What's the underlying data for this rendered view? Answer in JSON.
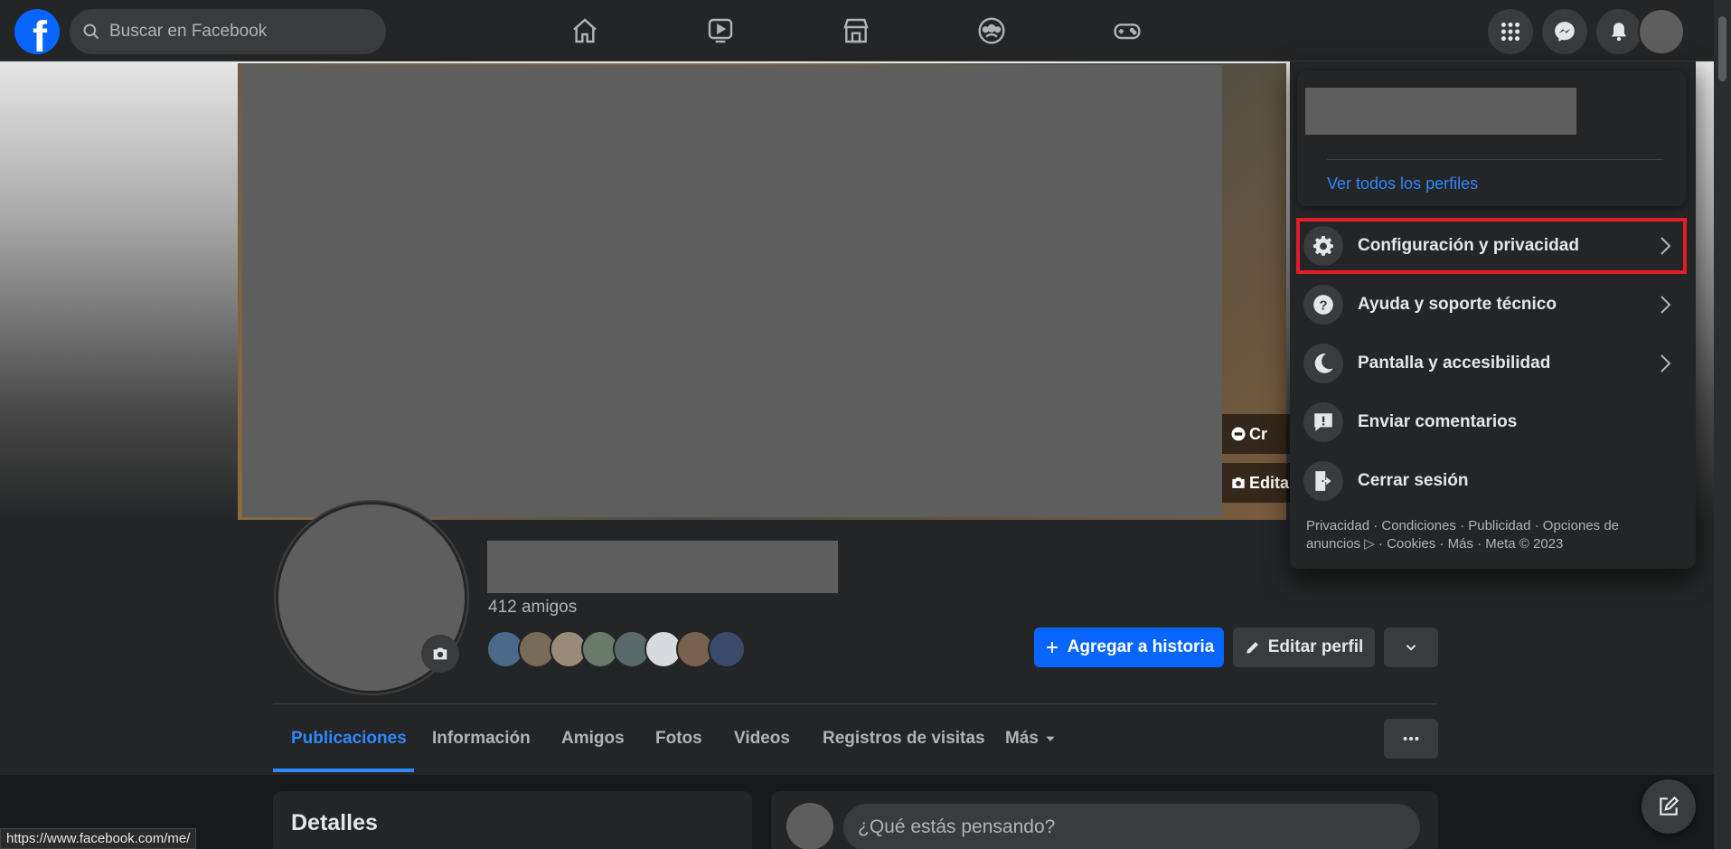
{
  "topbar": {
    "logo_letter": "f",
    "search_placeholder": "Buscar en Facebook",
    "nav_icons": [
      "home-icon",
      "video-icon",
      "marketplace-icon",
      "groups-icon",
      "gaming-icon"
    ],
    "right_icons": [
      "menu-grid-icon",
      "messenger-icon",
      "notifications-icon"
    ]
  },
  "profile": {
    "friends_count": "412 amigos",
    "add_story_label": "Agregar a historia",
    "edit_profile_label": "Editar perfil",
    "cover_buttons": [
      "Cr",
      "Edita"
    ]
  },
  "tabs": [
    "Publicaciones",
    "Información",
    "Amigos",
    "Fotos",
    "Videos",
    "Registros de visitas",
    "Más"
  ],
  "active_tab": "Publicaciones",
  "details": {
    "title": "Detalles"
  },
  "composer": {
    "placeholder": "¿Qué estás pensando?"
  },
  "dropdown": {
    "see_all_profiles": "Ver todos los perfiles",
    "items": [
      {
        "label": "Configuración y privacidad",
        "icon": "gear-icon",
        "has_chevron": true
      },
      {
        "label": "Ayuda y soporte técnico",
        "icon": "help-icon",
        "has_chevron": true
      },
      {
        "label": "Pantalla y accesibilidad",
        "icon": "moon-icon",
        "has_chevron": true
      },
      {
        "label": "Enviar comentarios",
        "icon": "feedback-icon",
        "has_chevron": false
      },
      {
        "label": "Cerrar sesión",
        "icon": "logout-icon",
        "has_chevron": false
      }
    ],
    "footer_line1": "Privacidad · Condiciones · Publicidad · Opciones de",
    "footer_line2": "anuncios ▷ · Cookies · Más · Meta © 2023"
  },
  "status_bar": {
    "url": "https://www.facebook.com/me/"
  },
  "colors": {
    "accent": "#0866ff",
    "link": "#2d88ff",
    "highlight_box": "#e11d27",
    "background": "#18191a",
    "surface": "#242526"
  }
}
